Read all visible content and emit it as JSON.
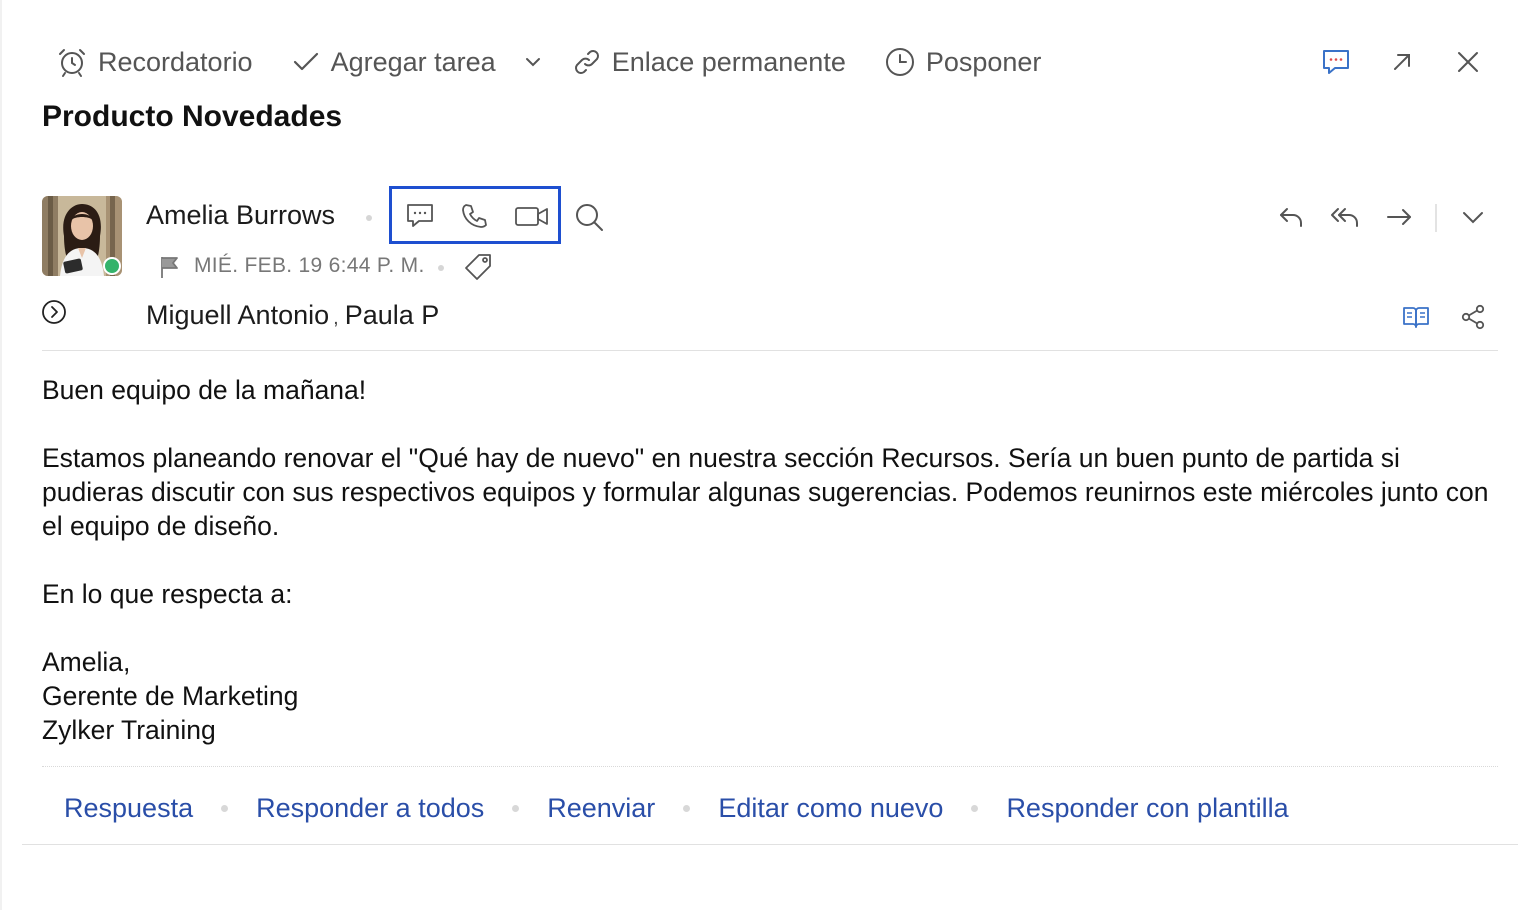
{
  "toolbar": {
    "reminder_label": "Recordatorio",
    "add_task_label": "Agregar tarea",
    "permalink_label": "Enlace permanente",
    "snooze_label": "Posponer"
  },
  "email": {
    "subject": "Producto Novedades",
    "sender_name": "Amelia Burrows",
    "date": "MIÉ. FEB. 19 6:44 P. M.",
    "recipients": [
      "Miguell Antonio",
      "Paula P"
    ],
    "recipient_separator": ",",
    "presence_status_color": "#34b36b",
    "body": {
      "greeting": "Buen equipo de la mañana!",
      "paragraph": "Estamos planeando renovar el \"Qué hay de nuevo\" en nuestra sección Recursos. Sería un buen punto de partida si pudieras discutir con sus respectivos equipos y formular algunas sugerencias. Podemos reunirnos este miércoles junto con el equipo de diseño.",
      "regarding": "En lo que respecta a:",
      "signature_name": "Amelia,",
      "signature_title": "Gerente de Marketing",
      "signature_company": "Zylker Training"
    }
  },
  "footer": {
    "reply": "Respuesta",
    "reply_all": "Responder a todos",
    "forward": "Reenviar",
    "edit_as_new": "Editar como nuevo",
    "reply_with_template": "Responder con plantilla"
  },
  "icons": {
    "toolbar": [
      "alarm-clock-icon",
      "checkmark-icon",
      "chevron-down-icon",
      "link-icon",
      "clock-icon"
    ],
    "window": [
      "chat-icon",
      "popout-arrow-icon",
      "close-icon"
    ],
    "contact": [
      "chat-icon",
      "phone-icon",
      "video-icon",
      "search-icon"
    ],
    "actions": [
      "reply-icon",
      "reply-all-icon",
      "forward-icon",
      "chevron-down-icon",
      "book-icon",
      "share-icon",
      "flag-icon",
      "tag-icon",
      "expand-circle-icon"
    ]
  },
  "colors": {
    "link_blue": "#2a4ea8",
    "highlight_border": "#1e4fd0",
    "icon_blue": "#3a72c8"
  }
}
